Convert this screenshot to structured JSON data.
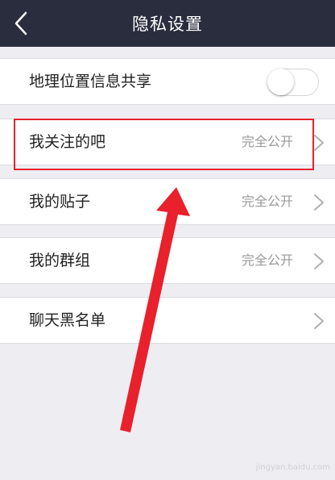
{
  "header": {
    "title": "隐私设置"
  },
  "location_share": {
    "label": "地理位置信息共享",
    "enabled": false
  },
  "items": [
    {
      "label": "我关注的吧",
      "value": "完全公开"
    },
    {
      "label": "我的贴子",
      "value": "完全公开"
    },
    {
      "label": "我的群组",
      "value": "完全公开"
    },
    {
      "label": "聊天黑名单",
      "value": ""
    }
  ],
  "watermark": "jingyan.baidu.com",
  "colors": {
    "header_bg": "#2a2d3e",
    "annotation": "#e8212d"
  }
}
